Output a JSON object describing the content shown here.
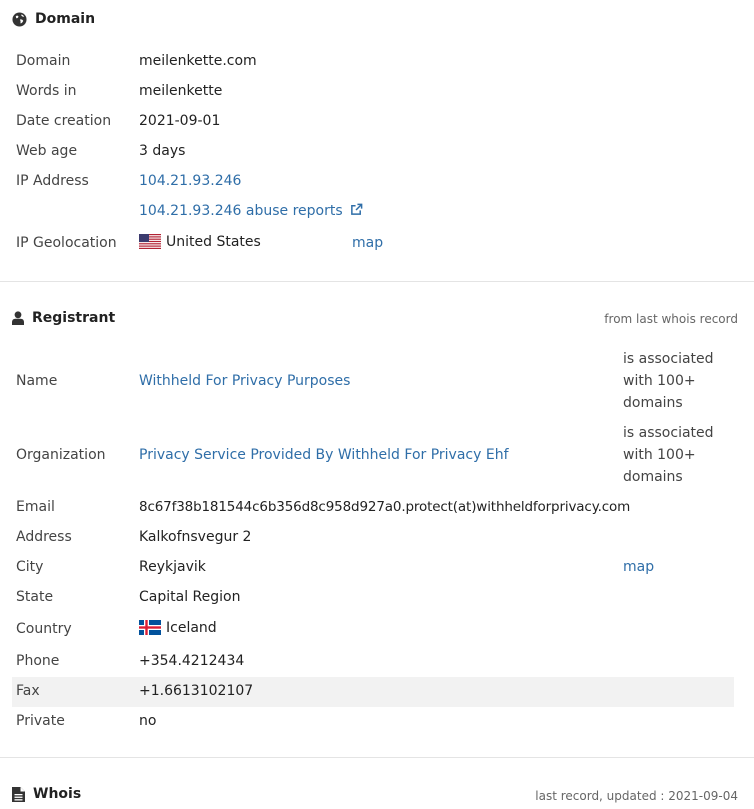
{
  "domain_section": {
    "title": "Domain",
    "rows": {
      "domain": {
        "label": "Domain",
        "value": "meilenkette.com"
      },
      "words": {
        "label": "Words in",
        "value": "meilenkette"
      },
      "date": {
        "label": "Date creation",
        "value": "2021-09-01"
      },
      "age": {
        "label": "Web age",
        "value": "3 days"
      },
      "ip": {
        "label": "IP Address",
        "value": "104.21.93.246"
      },
      "abuse": {
        "value": "104.21.93.246 abuse reports"
      },
      "geo": {
        "label": "IP Geolocation",
        "value": "United States",
        "map": "map"
      }
    }
  },
  "registrant_section": {
    "title": "Registrant",
    "note": "from last whois record",
    "rows": {
      "name": {
        "label": "Name",
        "value": "Withheld For Privacy Purposes",
        "assoc": [
          "is associated",
          "with 100+",
          "domains"
        ]
      },
      "org": {
        "label": "Organization",
        "value": "Privacy Service Provided By Withheld For Privacy Ehf",
        "assoc": [
          "is associated",
          "with 100+",
          "domains"
        ]
      },
      "email": {
        "label": "Email",
        "value": "8c67f38b181544c6b356d8c958d927a0.protect(at)withheldforprivacy.com"
      },
      "address": {
        "label": "Address",
        "value": "Kalkofnsvegur 2"
      },
      "city": {
        "label": "City",
        "value": "Reykjavik",
        "map": "map"
      },
      "state": {
        "label": "State",
        "value": "Capital Region"
      },
      "country": {
        "label": "Country",
        "value": "Iceland"
      },
      "phone": {
        "label": "Phone",
        "value": "+354.4212434"
      },
      "fax": {
        "label": "Fax",
        "value": "+1.6613102107"
      },
      "private": {
        "label": "Private",
        "value": "no"
      }
    }
  },
  "whois_section": {
    "title": "Whois",
    "note": "last record, updated : 2021-09-04"
  },
  "colors": {
    "link": "#2f6ea8",
    "text": "#222222",
    "muted": "#666666"
  },
  "icons": [
    "globe-icon",
    "user-icon",
    "external-link-icon",
    "us-flag-icon",
    "iceland-flag-icon",
    "document-icon"
  ]
}
